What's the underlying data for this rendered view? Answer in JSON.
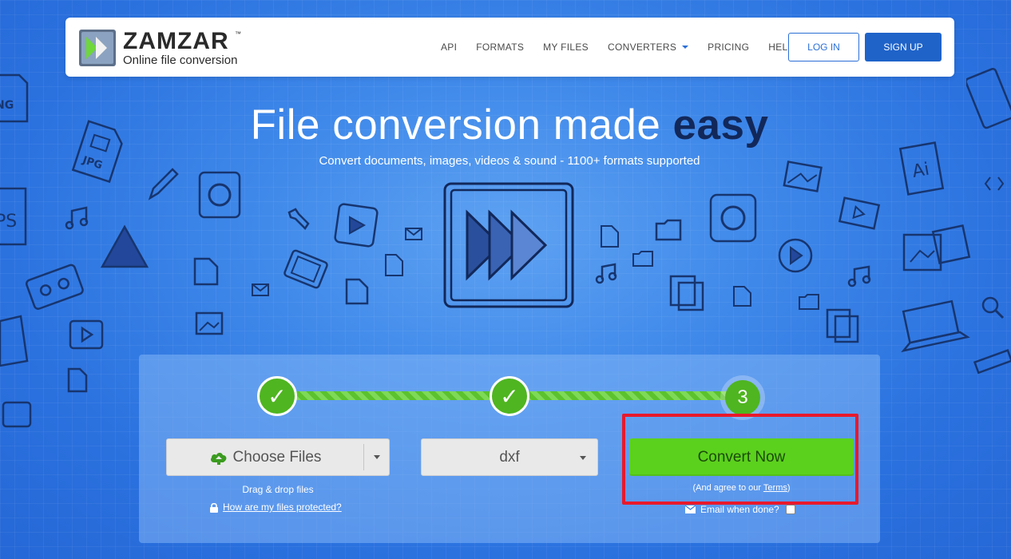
{
  "brand": {
    "name": "ZAMZAR",
    "tm": "™",
    "tagline": "Online file conversion"
  },
  "nav": {
    "items": [
      "API",
      "FORMATS",
      "MY FILES",
      "CONVERTERS",
      "PRICING",
      "HELP"
    ],
    "login": "LOG IN",
    "signup": "SIGN UP"
  },
  "hero": {
    "title_light": "File conversion made ",
    "title_bold": "easy",
    "subtitle": "Convert documents, images, videos & sound - 1100+ formats supported"
  },
  "steps": {
    "step1": "✓",
    "step2": "✓",
    "step3": "3"
  },
  "upload": {
    "choose_label": "Choose Files",
    "drag_text": "Drag & drop files",
    "protected_link": "How are my files protected?"
  },
  "format": {
    "selected": "dxf"
  },
  "convert": {
    "button": "Convert Now",
    "agree_prefix": "(And agree to our ",
    "terms_link": "Terms",
    "agree_suffix": ")",
    "email_label": "Email when done?"
  },
  "doodle_labels": {
    "png": "NG",
    "jpg": "JPG",
    "ai": "Ai",
    "ps": "PS"
  },
  "colors": {
    "background": "#2f7be6",
    "accent": "#1f63c9",
    "convert_green": "#5bd11d",
    "step_green": "#4fb520",
    "highlight_red": "#e8192c",
    "title_dark": "#12285a"
  }
}
